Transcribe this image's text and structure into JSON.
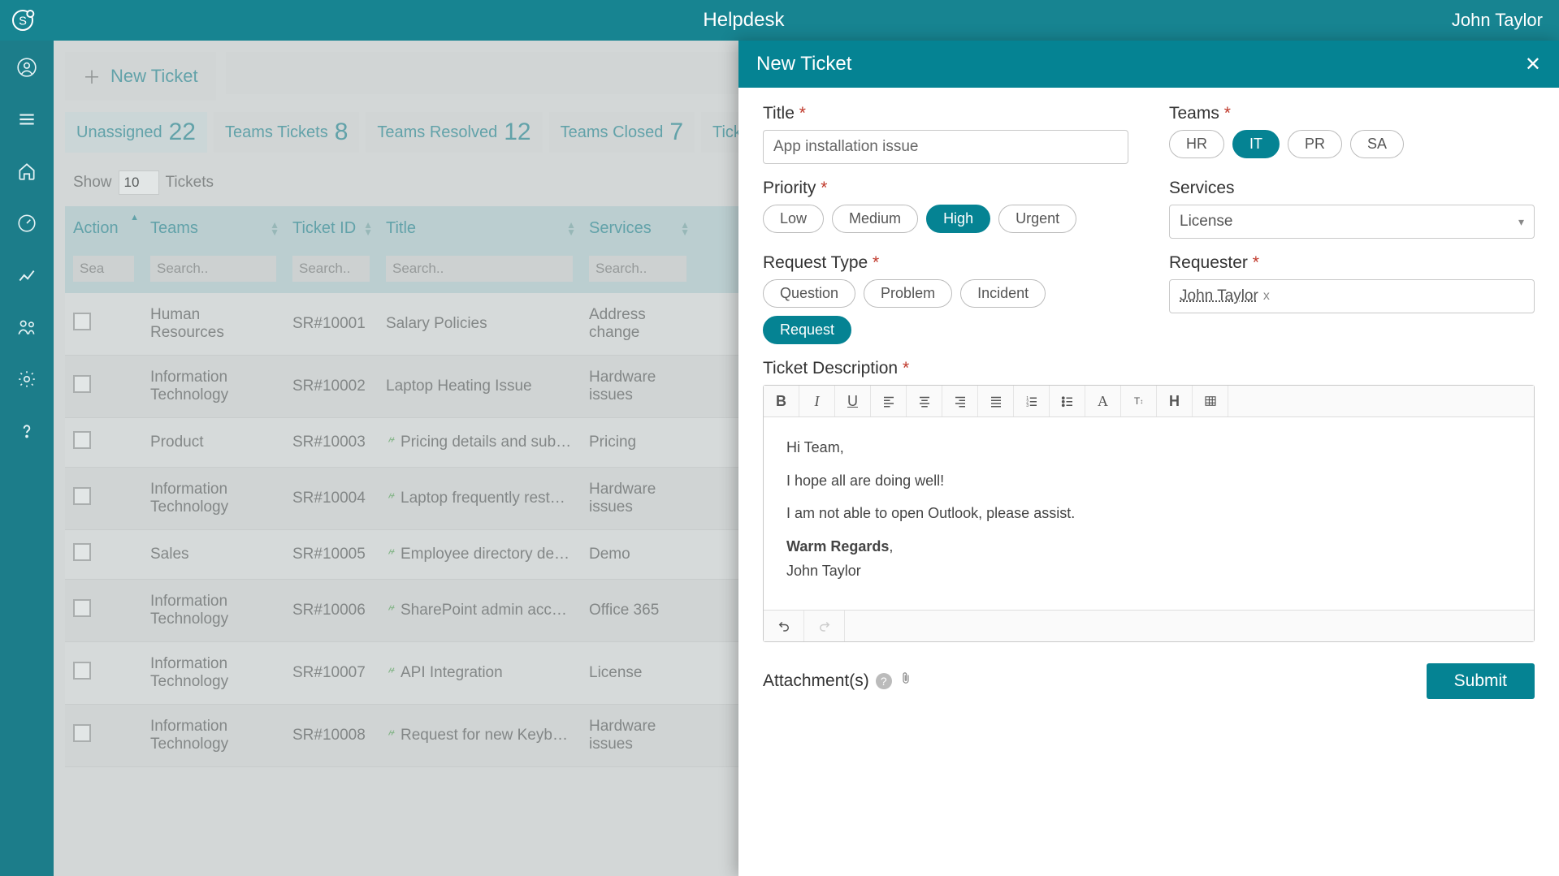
{
  "app": {
    "title": "Helpdesk",
    "user": "John Taylor"
  },
  "actions": {
    "new_ticket": "New Ticket"
  },
  "tabs": [
    {
      "label": "Unassigned",
      "count": "22",
      "active": true
    },
    {
      "label": "Teams Tickets",
      "count": "8"
    },
    {
      "label": "Teams Resolved",
      "count": "12"
    },
    {
      "label": "Teams Closed",
      "count": "7"
    },
    {
      "label": "Ticket",
      "count": ""
    }
  ],
  "show": {
    "label": "Show",
    "value": "10",
    "suffix": "Tickets"
  },
  "columns": {
    "action": "Action",
    "teams": "Teams",
    "ticket_id": "Ticket ID",
    "title": "Title",
    "services": "Services"
  },
  "search_placeholder": {
    "action": "Sea",
    "generic": "Search.."
  },
  "rows": [
    {
      "team": "Human Resources",
      "id": "SR#10001",
      "title": "Salary Policies",
      "service": "Address change",
      "leaf": false
    },
    {
      "team": "Information Technology",
      "id": "SR#10002",
      "title": "Laptop Heating Issue",
      "service": "Hardware issues",
      "leaf": false
    },
    {
      "team": "Product",
      "id": "SR#10003",
      "title": "Pricing details and subscript",
      "service": "Pricing",
      "leaf": true
    },
    {
      "team": "Information Technology",
      "id": "SR#10004",
      "title": "Laptop frequently restarting",
      "service": "Hardware issues",
      "leaf": true
    },
    {
      "team": "Sales",
      "id": "SR#10005",
      "title": "Employee directory demo",
      "service": "Demo",
      "leaf": true
    },
    {
      "team": "Information Technology",
      "id": "SR#10006",
      "title": "SharePoint admin access",
      "service": "Office 365",
      "leaf": true
    },
    {
      "team": "Information Technology",
      "id": "SR#10007",
      "title": "API Integration",
      "service": "License",
      "leaf": true
    },
    {
      "team": "Information Technology",
      "id": "SR#10008",
      "title": "Request for new Keyboard…",
      "service": "Hardware issues",
      "leaf": true
    }
  ],
  "panel": {
    "header": "New Ticket",
    "title_label": "Title",
    "title_value": "App installation issue",
    "teams_label": "Teams",
    "teams": [
      "HR",
      "IT",
      "PR",
      "SA"
    ],
    "teams_active": "IT",
    "priority_label": "Priority",
    "priorities": [
      "Low",
      "Medium",
      "High",
      "Urgent"
    ],
    "priority_active": "High",
    "services_label": "Services",
    "services_value": "License",
    "request_type_label": "Request Type",
    "request_types": [
      "Question",
      "Problem",
      "Incident",
      "Request"
    ],
    "request_type_active": "Request",
    "requester_label": "Requester",
    "requester_value": "John Taylor",
    "description_label": "Ticket Description",
    "description_lines": {
      "l1": "Hi Team,",
      "l2": "I hope all are doing well!",
      "l3": "I am not able to open Outlook, please assist.",
      "l4a": "Warm Regards",
      "l4b": ",",
      "l5": "John Taylor"
    },
    "attachments_label": "Attachment(s)",
    "submit": "Submit"
  }
}
